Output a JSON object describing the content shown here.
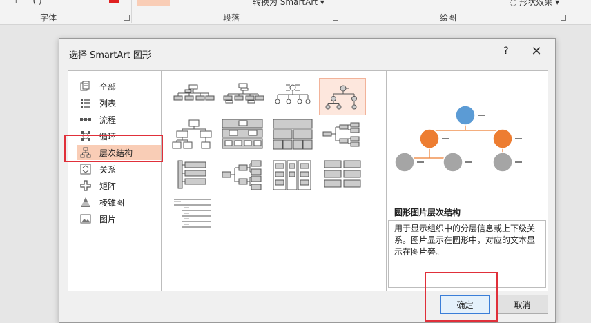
{
  "ribbon": {
    "groups": {
      "font": "字体",
      "paragraph": "段落",
      "drawing": "绘图"
    },
    "convert_label": "转换为 SmartArt",
    "effects_label": "形状效果"
  },
  "dialog": {
    "title": "选择 SmartArt 图形",
    "help": "?",
    "categories": [
      {
        "label": "全部",
        "icon": "all-icon"
      },
      {
        "label": "列表",
        "icon": "list-icon"
      },
      {
        "label": "流程",
        "icon": "process-icon"
      },
      {
        "label": "循环",
        "icon": "cycle-icon"
      },
      {
        "label": "层次结构",
        "icon": "hierarchy-icon",
        "selected": true
      },
      {
        "label": "关系",
        "icon": "relationship-icon"
      },
      {
        "label": "矩阵",
        "icon": "matrix-icon"
      },
      {
        "label": "棱锥图",
        "icon": "pyramid-icon"
      },
      {
        "label": "图片",
        "icon": "picture-icon"
      }
    ],
    "preview": {
      "title": "圆形图片层次结构",
      "description": "用于显示组织中的分层信息或上下级关系。图片显示在圆形中，对应的文本显示在图片旁。"
    },
    "ok_label": "确定",
    "cancel_label": "取消"
  },
  "colors": {
    "accent_orange": "#ed7d31",
    "node_blue": "#5b9bd5",
    "node_gray": "#a5a5a5",
    "selection_bg": "#f9cdb6",
    "highlight_red": "#e0303a"
  }
}
